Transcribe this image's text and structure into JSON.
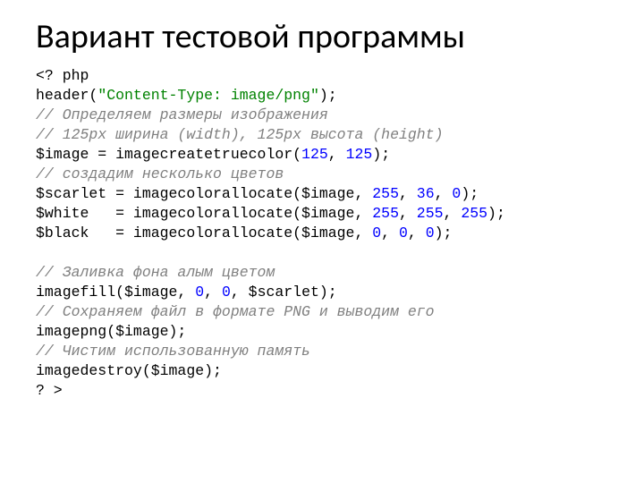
{
  "title": "Вариант тестовой программы",
  "code": {
    "l1": "<? php",
    "l2a": "header(",
    "l2b": "\"Content-Type: image/png\"",
    "l2c": ");",
    "l3": "// Определяем размеры изображения",
    "l4": "// 125px ширина (width), 125px высота (height)",
    "l5a": "$image = imagecreatetruecolor(",
    "l5b": "125",
    "l5c": ", ",
    "l5d": "125",
    "l5e": ");",
    "l6": "// создадим несколько цветов",
    "l7a": "$scarlet = imagecolorallocate($image, ",
    "l7b": "255",
    "l7c": ", ",
    "l7d": "36",
    "l7e": ", ",
    "l7f": "0",
    "l7g": ");",
    "l8a": "$white   = imagecolorallocate($image, ",
    "l8b": "255",
    "l8c": ", ",
    "l8d": "255",
    "l8e": ", ",
    "l8f": "255",
    "l8g": ");",
    "l9a": "$black   = imagecolorallocate($image, ",
    "l9b": "0",
    "l9c": ", ",
    "l9d": "0",
    "l9e": ", ",
    "l9f": "0",
    "l9g": ");",
    "l11": "// Заливка фона алым цветом",
    "l12a": "imagefill($image, ",
    "l12b": "0",
    "l12c": ", ",
    "l12d": "0",
    "l12e": ", $scarlet);",
    "l13": "// Сохраняем файл в формате PNG и выводим его",
    "l14": "imagepng($image);",
    "l15": "// Чистим использованную память",
    "l16": "imagedestroy($image);",
    "l17": "? >"
  }
}
